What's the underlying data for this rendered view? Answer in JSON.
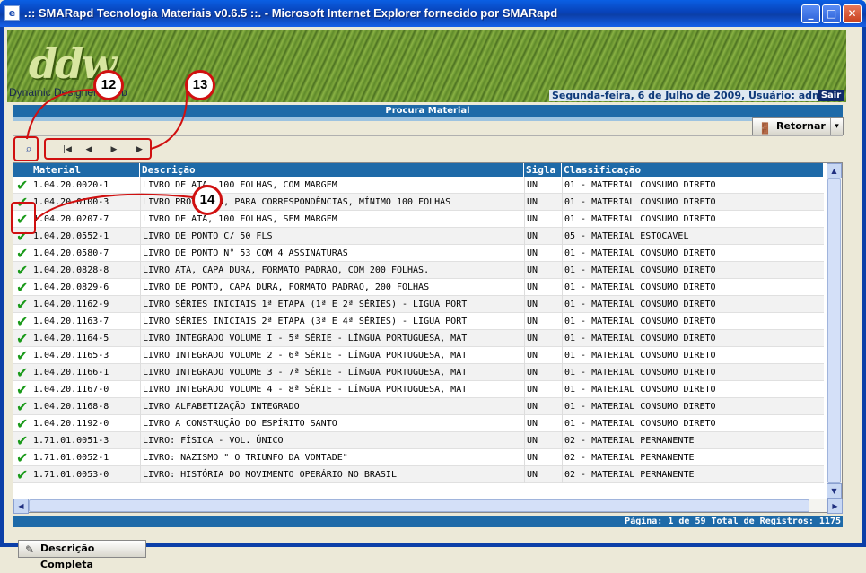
{
  "window": {
    "title": ".:: SMARapd Tecnologia Materiais v0.6.5 ::. - Microsoft Internet Explorer fornecido por SMARapd",
    "icon": "ie-page-icon",
    "minimize": "_",
    "maximize": "□",
    "close": "✕"
  },
  "banner": {
    "logo": "ddw",
    "logo_sub": "Dynamic Designers Web",
    "date_user": "Segunda-feira, 6 de Julho de 2009, Usuário: admin",
    "logout": "Sair"
  },
  "section_title": "Procura Material",
  "toolbar": {
    "return_label": "Retornar",
    "return_drop": "▾",
    "find_icon": "binoculars-icon",
    "nav": [
      "|◀",
      "◀",
      "▶",
      "▶|"
    ]
  },
  "grid": {
    "columns": [
      "Material",
      "Descrição",
      "Sigla",
      "Classificação"
    ],
    "rows": [
      [
        "1.04.20.0020-1",
        "LIVRO DE ATA, 100 FOLHAS, COM MARGEM",
        "UN",
        "01 - MATERIAL CONSUMO DIRETO"
      ],
      [
        "1.04.20.0100-3",
        "LIVRO PROTOCOLO, PARA CORRESPONDÊNCIAS, MÍNIMO 100 FOLHAS",
        "UN",
        "01 - MATERIAL CONSUMO DIRETO"
      ],
      [
        "1.04.20.0207-7",
        "LIVRO DE ATA, 100 FOLHAS, SEM MARGEM",
        "UN",
        "01 - MATERIAL CONSUMO DIRETO"
      ],
      [
        "1.04.20.0552-1",
        "LIVRO DE PONTO C/ 50 FLS",
        "UN",
        "05 - MATERIAL ESTOCAVEL"
      ],
      [
        "1.04.20.0580-7",
        "LIVRO DE PONTO N° 53 COM 4 ASSINATURAS",
        "UN",
        "01 - MATERIAL CONSUMO DIRETO"
      ],
      [
        "1.04.20.0828-8",
        "LIVRO ATA, CAPA DURA, FORMATO PADRÃO, COM 200 FOLHAS.",
        "UN",
        "01 - MATERIAL CONSUMO DIRETO"
      ],
      [
        "1.04.20.0829-6",
        "LIVRO DE PONTO, CAPA DURA, FORMATO PADRÃO, 200 FOLHAS",
        "UN",
        "01 - MATERIAL CONSUMO DIRETO"
      ],
      [
        "1.04.20.1162-9",
        "LIVRO SÉRIES INICIAIS 1ª ETAPA (1ª E 2ª SÉRIES) - LIGUA PORT",
        "UN",
        "01 - MATERIAL CONSUMO DIRETO"
      ],
      [
        "1.04.20.1163-7",
        "LIVRO SÉRIES INICIAIS 2ª ETAPA (3ª E 4ª SÉRIES) - LIGUA PORT",
        "UN",
        "01 - MATERIAL CONSUMO DIRETO"
      ],
      [
        "1.04.20.1164-5",
        "LIVRO INTEGRADO VOLUME I - 5ª SÉRIE - LÍNGUA PORTUGUESA, MAT",
        "UN",
        "01 - MATERIAL CONSUMO DIRETO"
      ],
      [
        "1.04.20.1165-3",
        "LIVRO INTEGRADO VOLUME 2 - 6ª SÉRIE - LÍNGUA PORTUGUESA, MAT",
        "UN",
        "01 - MATERIAL CONSUMO DIRETO"
      ],
      [
        "1.04.20.1166-1",
        "LIVRO INTEGRADO VOLUME 3 - 7ª SÉRIE - LÍNGUA PORTUGUESA, MAT",
        "UN",
        "01 - MATERIAL CONSUMO DIRETO"
      ],
      [
        "1.04.20.1167-0",
        "LIVRO INTEGRADO VOLUME 4 - 8ª SÉRIE - LÍNGUA PORTUGUESA, MAT",
        "UN",
        "01 - MATERIAL CONSUMO DIRETO"
      ],
      [
        "1.04.20.1168-8",
        "LIVRO ALFABETIZAÇÃO INTEGRADO",
        "UN",
        "01 - MATERIAL CONSUMO DIRETO"
      ],
      [
        "1.04.20.1192-0",
        "LIVRO A CONSTRUÇÃO DO ESPÍRITO SANTO",
        "UN",
        "01 - MATERIAL CONSUMO DIRETO"
      ],
      [
        "1.71.01.0051-3",
        "LIVRO: FÍSICA - VOL. ÚNICO",
        "UN",
        "02 - MATERIAL PERMANENTE"
      ],
      [
        "1.71.01.0052-1",
        "LIVRO: NAZISMO \" O TRIUNFO DA VONTADE\"",
        "UN",
        "02 - MATERIAL PERMANENTE"
      ],
      [
        "1.71.01.0053-0",
        "LIVRO: HISTÓRIA DO MOVIMENTO OPERÁRIO NO BRASIL",
        "UN",
        "02 - MATERIAL PERMANENTE"
      ]
    ],
    "check_glyph": "✔"
  },
  "footer": "Página: 1 de 59 Total de Registros: 1175",
  "fulldesc_label": "Descrição Completa",
  "callouts": {
    "c12": "12",
    "c13": "13",
    "c14": "14"
  },
  "colors": {
    "accent": "#1e6aa8",
    "annotation": "#d01010",
    "check": "#1a9a1a"
  }
}
